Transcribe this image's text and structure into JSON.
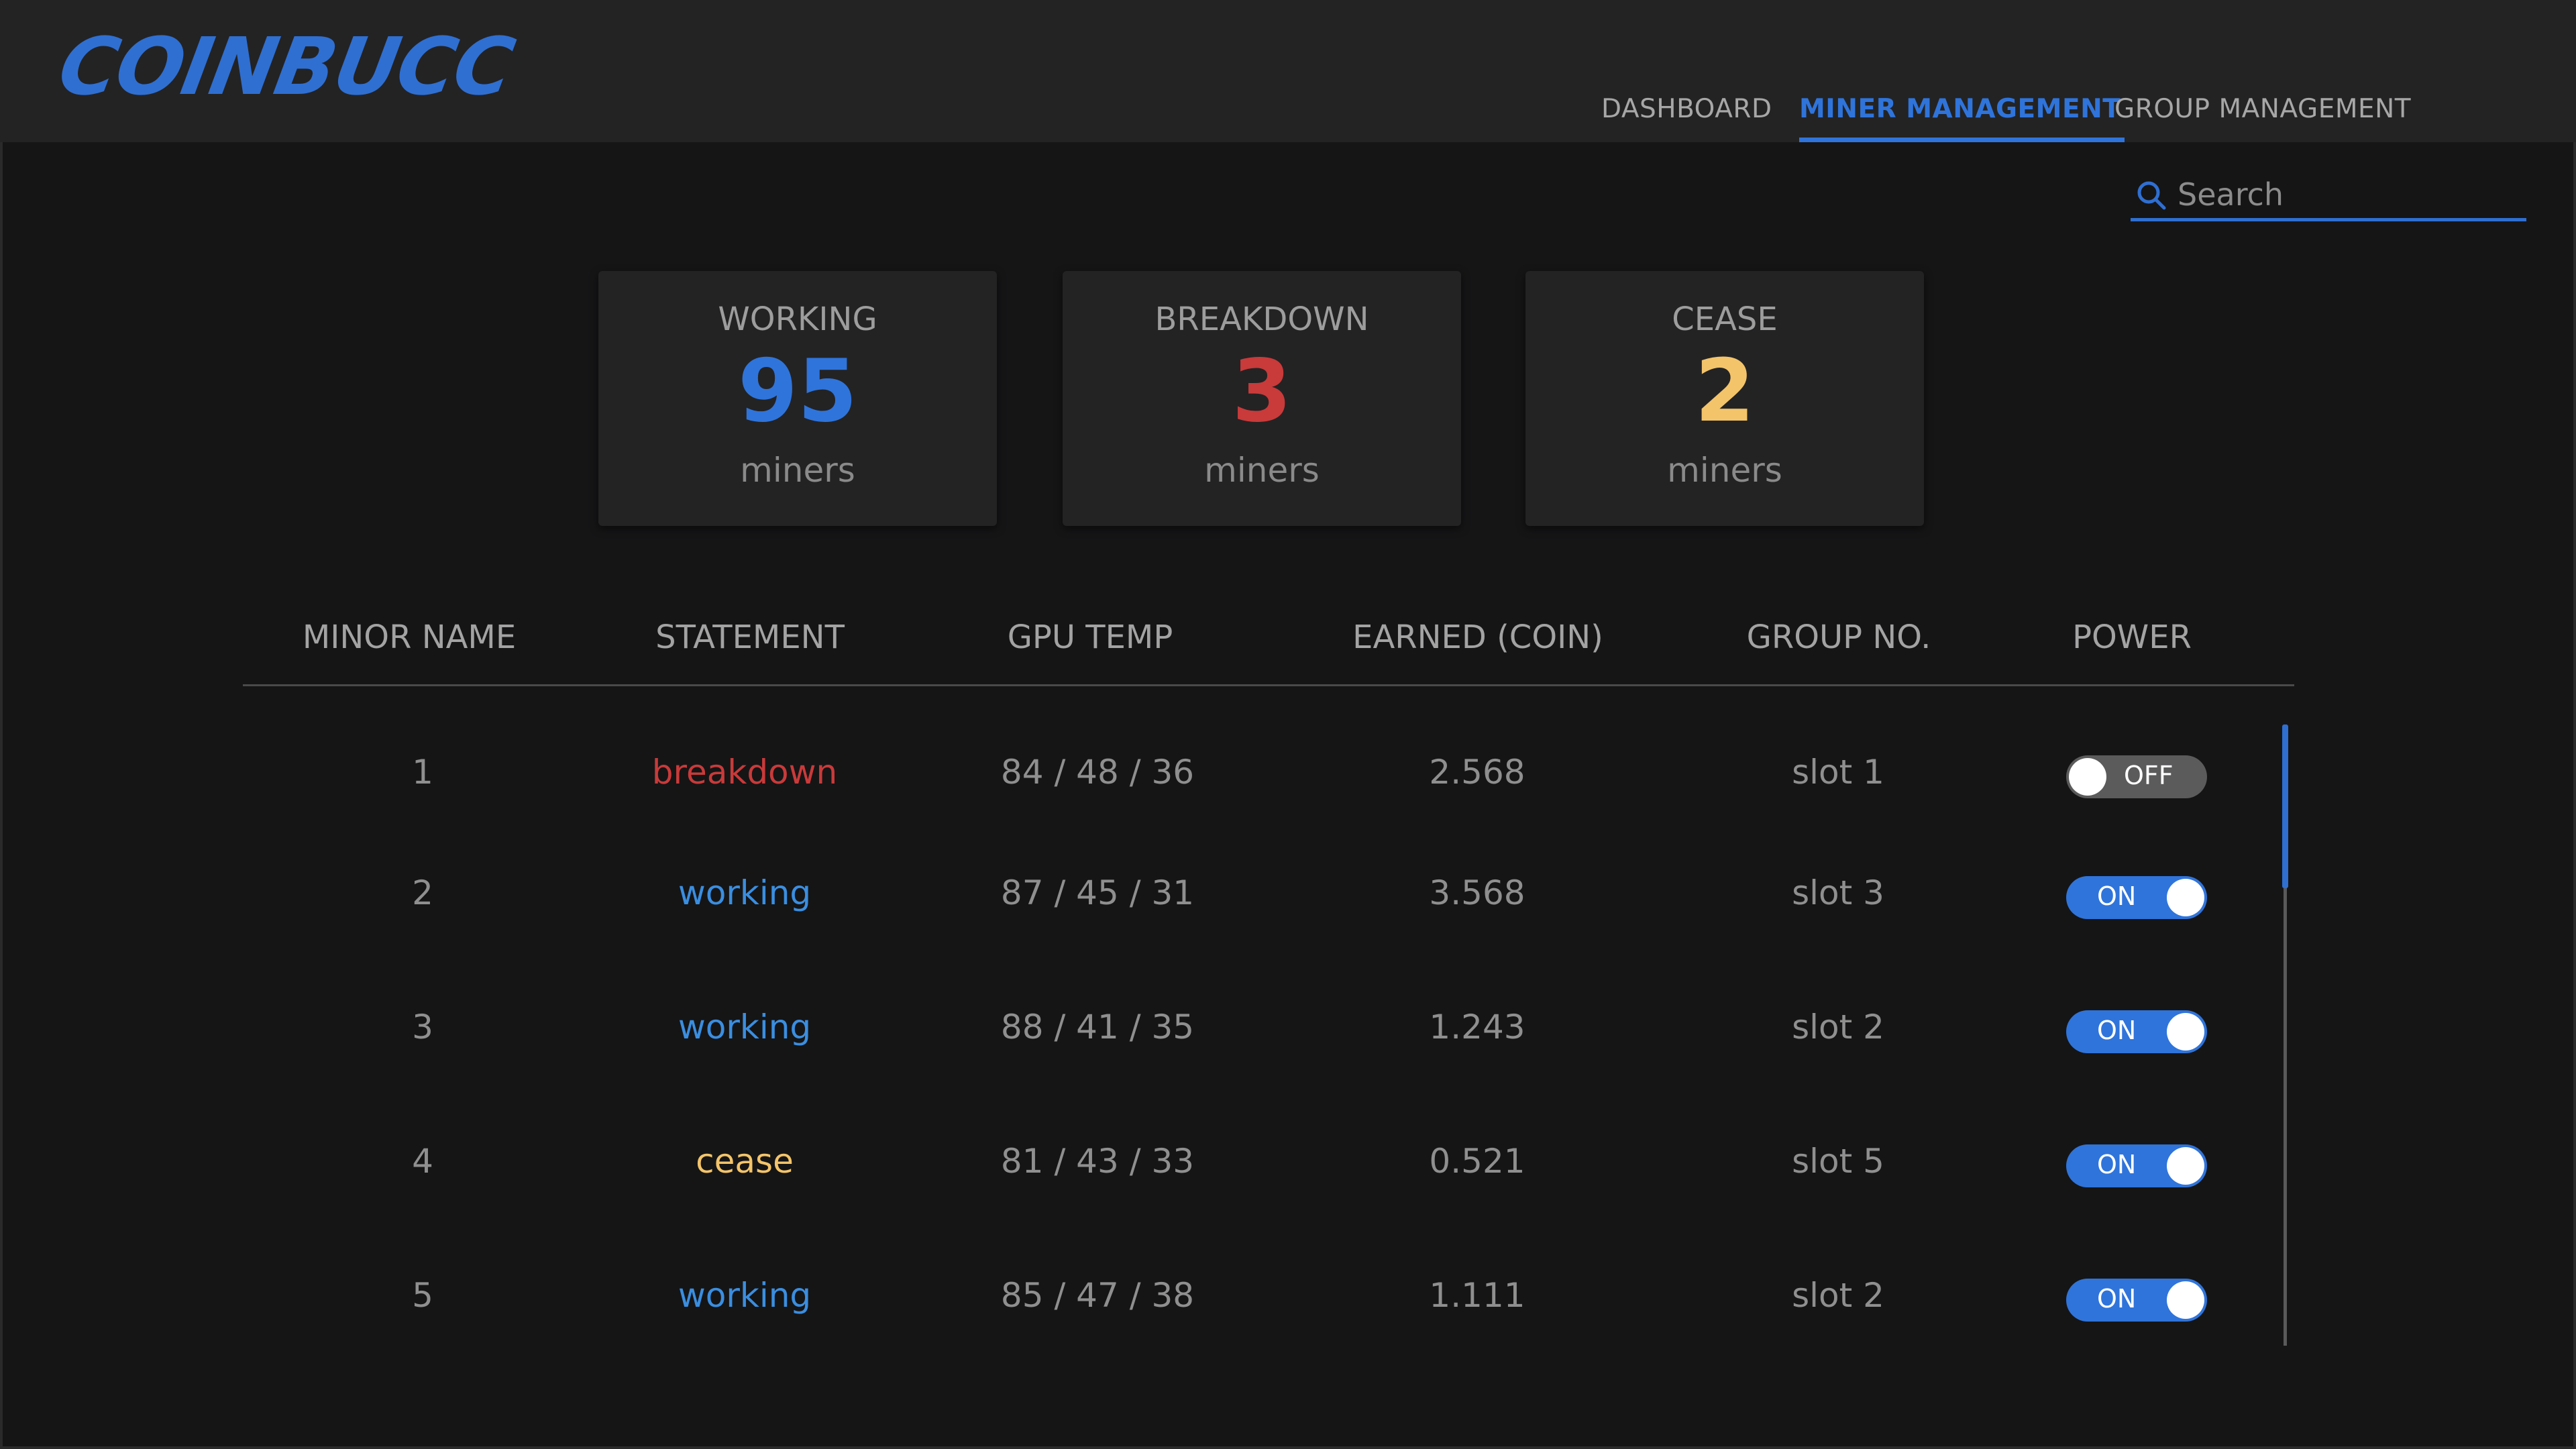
{
  "app": {
    "logo": "COINBUCC"
  },
  "nav": {
    "items": [
      {
        "label": "DASHBOARD",
        "active": false
      },
      {
        "label": "MINER MANAGEMENT",
        "active": true
      },
      {
        "label": "GROUP MANAGEMENT",
        "active": false
      }
    ]
  },
  "search": {
    "placeholder": "Search",
    "value": ""
  },
  "stats": [
    {
      "title": "WORKING",
      "value": "95",
      "unit": "miners",
      "color": "#2f74db"
    },
    {
      "title": "BREAKDOWN",
      "value": "3",
      "unit": "miners",
      "color": "#c93a3a"
    },
    {
      "title": "CEASE",
      "value": "2",
      "unit": "miners",
      "color": "#f3c46a"
    }
  ],
  "table": {
    "headers": [
      "MINOR NAME",
      "STATEMENT",
      "GPU TEMP",
      "EARNED (COIN)",
      "GROUP NO.",
      "POWER"
    ],
    "rows": [
      {
        "name": "1",
        "statement": "breakdown",
        "gpu_temp": "84 / 48 / 36",
        "earned": "2.568",
        "group": "slot 1",
        "power": "OFF"
      },
      {
        "name": "2",
        "statement": "working",
        "gpu_temp": "87 / 45 / 31",
        "earned": "3.568",
        "group": "slot 3",
        "power": "ON"
      },
      {
        "name": "3",
        "statement": "working",
        "gpu_temp": "88 / 41 / 35",
        "earned": "1.243",
        "group": "slot 2",
        "power": "ON"
      },
      {
        "name": "4",
        "statement": "cease",
        "gpu_temp": "81 / 43 / 33",
        "earned": "0.521",
        "group": "slot 5",
        "power": "ON"
      },
      {
        "name": "5",
        "statement": "working",
        "gpu_temp": "85 / 47 / 38",
        "earned": "1.111",
        "group": "slot 2",
        "power": "ON"
      }
    ]
  },
  "colors": {
    "accent": "#2f74db",
    "breakdown": "#c93a3a",
    "working": "#3a8ee0",
    "cease": "#f3c46a",
    "toggle_off": "#5b5b5c"
  }
}
